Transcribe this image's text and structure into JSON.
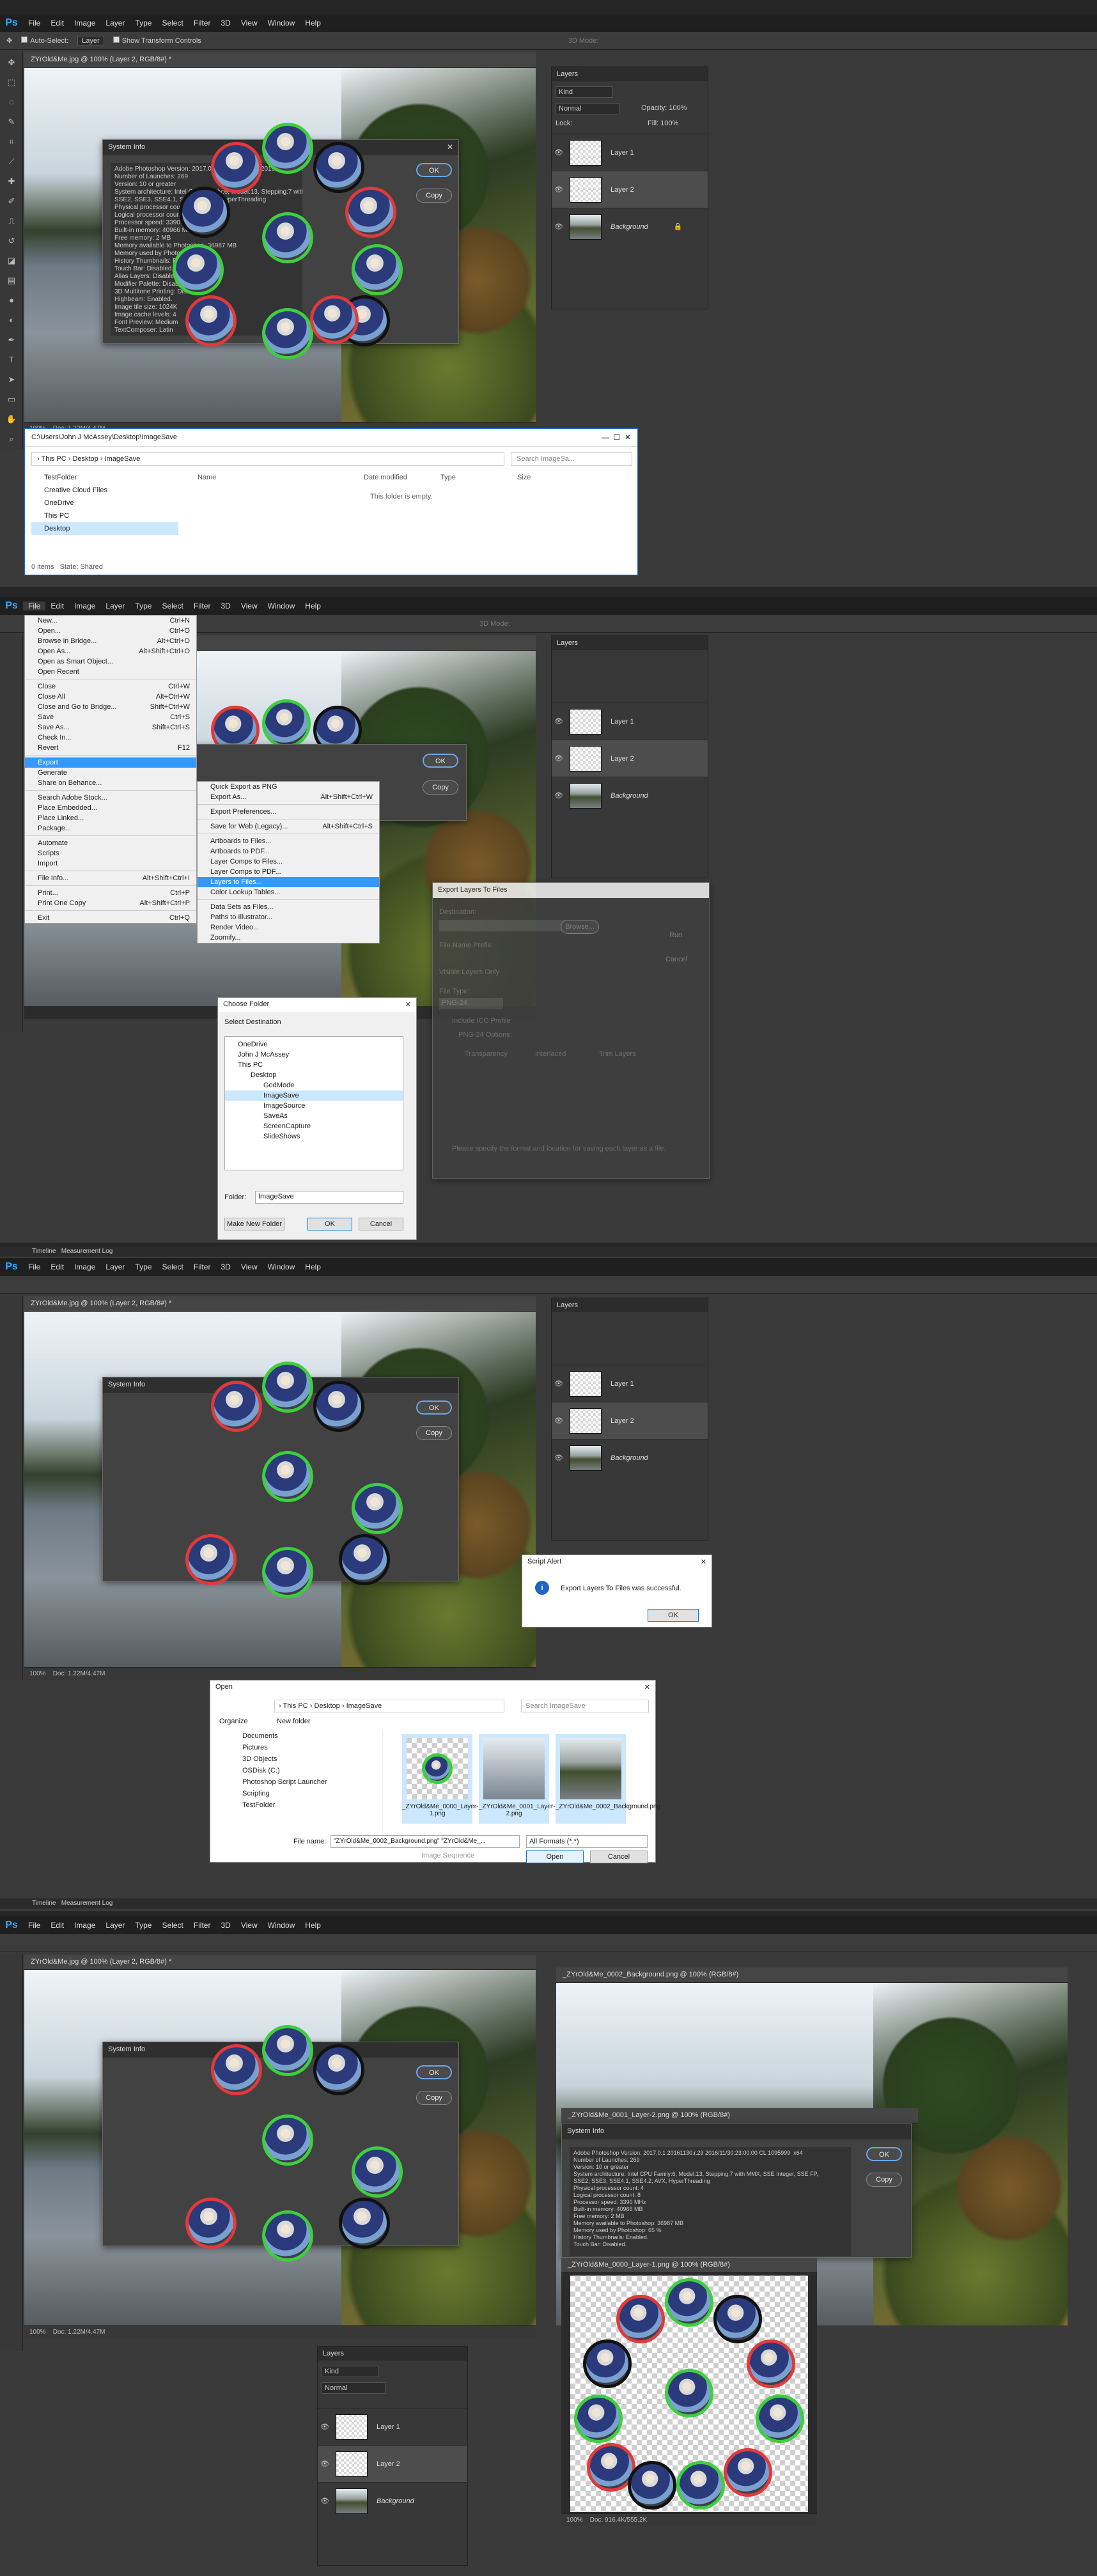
{
  "app": {
    "logo": "Ps",
    "menus": [
      "File",
      "Edit",
      "Image",
      "Layer",
      "Type",
      "Select",
      "Filter",
      "3D",
      "View",
      "Window",
      "Help"
    ],
    "options": {
      "auto_select": "Auto-Select:",
      "auto_target": "Layer",
      "show_transform": "Show Transform Controls",
      "mode3d": "3D Mode:"
    }
  },
  "doc_title": "ZYrOld&Me.jpg @ 100% (Layer 2, RGB/8#) *",
  "status": {
    "zoom": "100%",
    "doc": "Doc: 1.22M/4.47M"
  },
  "system_info": {
    "title": "System Info",
    "ok": "OK",
    "copy": "Copy",
    "lines": [
      "Adobe Photoshop Version: 2017.0.1 20161130.r.29 2016/11/30:23:00:00 CL 1095999  x64",
      "Number of Launches: 269",
      "Version: 10 or greater",
      "System architecture: Intel CPU Family:6, Model:13, Stepping:7 with MMX, SSE Integer, SSE FP,",
      "SSE2, SSE3, SSE4.1, SSE4.2, AVX, HyperThreading",
      "Physical processor count: 4",
      "Logical processor count: 8",
      "Processor speed: 3390 MHz",
      "Built-in memory: 40966 MB",
      "Free memory: 2 MB",
      "Memory available to Photoshop: 36987 MB",
      "Memory used by Photoshop: 65 %",
      "History Thumbnails: Enabled.",
      "Touch Bar: Disabled.",
      "Alias Layers: Disabled.",
      "Modifier Palette: Disabled.",
      "3D Multitone Printing: Disabled.",
      "Highbeam: Enabled.",
      "Image tile size: 1024K",
      "Image cache levels: 4",
      "Font Preview: Medium",
      "TextComposer: Latin"
    ]
  },
  "layers": {
    "title": "Layers",
    "kind": "Kind",
    "blend": "Normal",
    "opacity_label": "Opacity:",
    "opacity": "100%",
    "fill_label": "Fill:",
    "fill": "100%",
    "lock": "Lock:",
    "items": [
      {
        "name": "Layer 1"
      },
      {
        "name": "Layer 2"
      },
      {
        "name": "Background"
      }
    ]
  },
  "explorer": {
    "path": "C:\\Users\\John J McAssey\\Desktop\\ImageSave",
    "crumbs": [
      "This PC",
      "Desktop",
      "ImageSave"
    ],
    "search": "Search ImageSa...",
    "cols": [
      "Name",
      "Date modified",
      "Type",
      "Size"
    ],
    "empty": "This folder is empty.",
    "tree": [
      "TestFolder",
      "Creative Cloud Files",
      "OneDrive",
      "This PC",
      "Desktop"
    ],
    "items_status": "0 items",
    "state": "State: Shared"
  },
  "file_menu": {
    "items": [
      [
        "New...",
        "Ctrl+N"
      ],
      [
        "Open...",
        "Ctrl+O"
      ],
      [
        "Browse in Bridge...",
        "Alt+Ctrl+O"
      ],
      [
        "Open As...",
        "Alt+Shift+Ctrl+O"
      ],
      [
        "Open as Smart Object...",
        ""
      ],
      [
        "Open Recent",
        ""
      ],
      [
        "",
        ""
      ],
      [
        "Close",
        "Ctrl+W"
      ],
      [
        "Close All",
        "Alt+Ctrl+W"
      ],
      [
        "Close and Go to Bridge...",
        "Shift+Ctrl+W"
      ],
      [
        "Save",
        "Ctrl+S"
      ],
      [
        "Save As...",
        "Shift+Ctrl+S"
      ],
      [
        "Check In...",
        ""
      ],
      [
        "Revert",
        "F12"
      ],
      [
        "",
        ""
      ],
      [
        "Export",
        ""
      ],
      [
        "Generate",
        ""
      ],
      [
        "Share on Behance...",
        ""
      ],
      [
        "",
        ""
      ],
      [
        "Search Adobe Stock...",
        ""
      ],
      [
        "Place Embedded...",
        ""
      ],
      [
        "Place Linked...",
        ""
      ],
      [
        "Package...",
        ""
      ],
      [
        "",
        ""
      ],
      [
        "Automate",
        ""
      ],
      [
        "Scripts",
        ""
      ],
      [
        "Import",
        ""
      ],
      [
        "",
        ""
      ],
      [
        "File Info...",
        "Alt+Shift+Ctrl+I"
      ],
      [
        "",
        ""
      ],
      [
        "Print...",
        "Ctrl+P"
      ],
      [
        "Print One Copy",
        "Alt+Shift+Ctrl+P"
      ],
      [
        "",
        ""
      ],
      [
        "Exit",
        "Ctrl+Q"
      ]
    ]
  },
  "export_menu": {
    "items": [
      [
        "Quick Export as PNG",
        ""
      ],
      [
        "Export As...",
        "Alt+Shift+Ctrl+W"
      ],
      [
        "",
        ""
      ],
      [
        "Export Preferences...",
        ""
      ],
      [
        "",
        ""
      ],
      [
        "Save for Web (Legacy)...",
        "Alt+Shift+Ctrl+S"
      ],
      [
        "",
        ""
      ],
      [
        "Artboards to Files...",
        ""
      ],
      [
        "Artboards to PDF...",
        ""
      ],
      [
        "Layer Comps to Files...",
        ""
      ],
      [
        "Layer Comps to PDF...",
        ""
      ],
      [
        "Layers to Files...",
        ""
      ],
      [
        "Color Lookup Tables...",
        ""
      ],
      [
        "",
        ""
      ],
      [
        "Data Sets as Files...",
        ""
      ],
      [
        "Paths to Illustrator...",
        ""
      ],
      [
        "Render Video...",
        ""
      ],
      [
        "Zoomify...",
        ""
      ]
    ]
  },
  "export_layers": {
    "title": "Export Layers To Files",
    "destination": "Destination:",
    "browse": "Browse...",
    "prefix": "File Name Prefix:",
    "visible": "Visible Layers Only",
    "filetype": "File Type:",
    "png": "PNG-24",
    "icc": "Include ICC Profile",
    "png_opts": "PNG-24 Options:",
    "transp": "Transparency",
    "interlaced": "Interlaced",
    "trim": "Trim Layers",
    "run": "Run",
    "cancel": "Cancel",
    "note": "Please specify the format and location for saving each layer as a file."
  },
  "choose_folder": {
    "title": "Choose Folder",
    "select": "Select Destination",
    "tree": [
      "OneDrive",
      "John J McAssey",
      "This PC",
      "Desktop",
      "GodMode",
      "ImageSave",
      "ImageSource",
      "SaveAs",
      "ScreenCapture",
      "SlideShows"
    ],
    "folder_label": "Folder:",
    "folder_value": "ImageSave",
    "make": "Make New Folder",
    "ok": "OK",
    "cancel": "Cancel"
  },
  "alert": {
    "title": "Script Alert",
    "msg": "Export Layers To Files was successful.",
    "ok": "OK"
  },
  "open_dialog": {
    "title": "Open",
    "crumbs": [
      "This PC",
      "Desktop",
      "ImageSave"
    ],
    "search": "Search ImageSave",
    "organize": "Organize",
    "new_folder": "New folder",
    "tree": [
      "Documents",
      "Pictures",
      "3D Objects",
      "OSDisk (C:)",
      "Photoshop Script Launcher",
      "Scripting",
      "TestFolder"
    ],
    "files": [
      "_ZYrOld&Me_0000_Layer-1.png",
      "_ZYrOld&Me_0001_Layer-2.png",
      "_ZYrOld&Me_0002_Background.png"
    ],
    "filename_label": "File name:",
    "filename": "\"ZYrOld&Me_0002_Background.png\" \"ZYrOld&Me_...",
    "format": "All Formats (*.*)",
    "sequence": "Image Sequence",
    "open": "Open",
    "cancel": "Cancel"
  },
  "timeline": {
    "tab1": "Timeline",
    "tab2": "Measurement Log"
  },
  "docs4": {
    "bg": "_ZYrOld&Me_0002_Background.png @ 100% (RGB/8#)",
    "l2": "_ZYrOld&Me_0001_Layer-2.png @ 100% (RGB/8#)",
    "l1": "_ZYrOld&Me_0000_Layer-1.png @ 100% (RGB/8#)",
    "status": "Doc: 916.4K/555.2K"
  }
}
